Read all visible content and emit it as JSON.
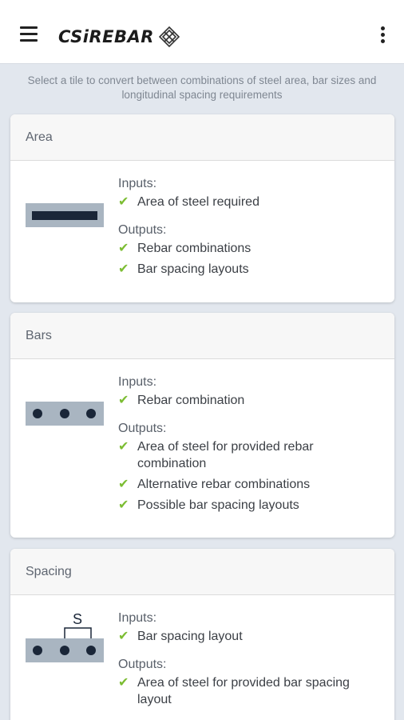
{
  "app": {
    "logo_text": "CSiREBAR"
  },
  "intro_text": "Select a tile to convert between combinations of steel area, bar sizes and longitudinal spacing requirements",
  "colors": {
    "check": "#7cbd33",
    "section_fill": "#a9b5c1",
    "bar": "#1a2638"
  },
  "cards": {
    "area": {
      "title": "Area",
      "inputs_label": "Inputs:",
      "inputs": [
        "Area of steel required"
      ],
      "outputs_label": "Outputs:",
      "outputs": [
        "Rebar combinations",
        "Bar spacing layouts"
      ]
    },
    "bars": {
      "title": "Bars",
      "inputs_label": "Inputs:",
      "inputs": [
        "Rebar combination"
      ],
      "outputs_label": "Outputs:",
      "outputs": [
        "Area of steel for provided rebar combination",
        "Alternative rebar combinations",
        "Possible bar spacing layouts"
      ]
    },
    "spacing": {
      "title": "Spacing",
      "illus_label": "S",
      "inputs_label": "Inputs:",
      "inputs": [
        "Bar spacing layout"
      ],
      "outputs_label": "Outputs:",
      "outputs": [
        "Area of steel for provided bar spacing layout"
      ]
    }
  },
  "check_glyph": "✔"
}
